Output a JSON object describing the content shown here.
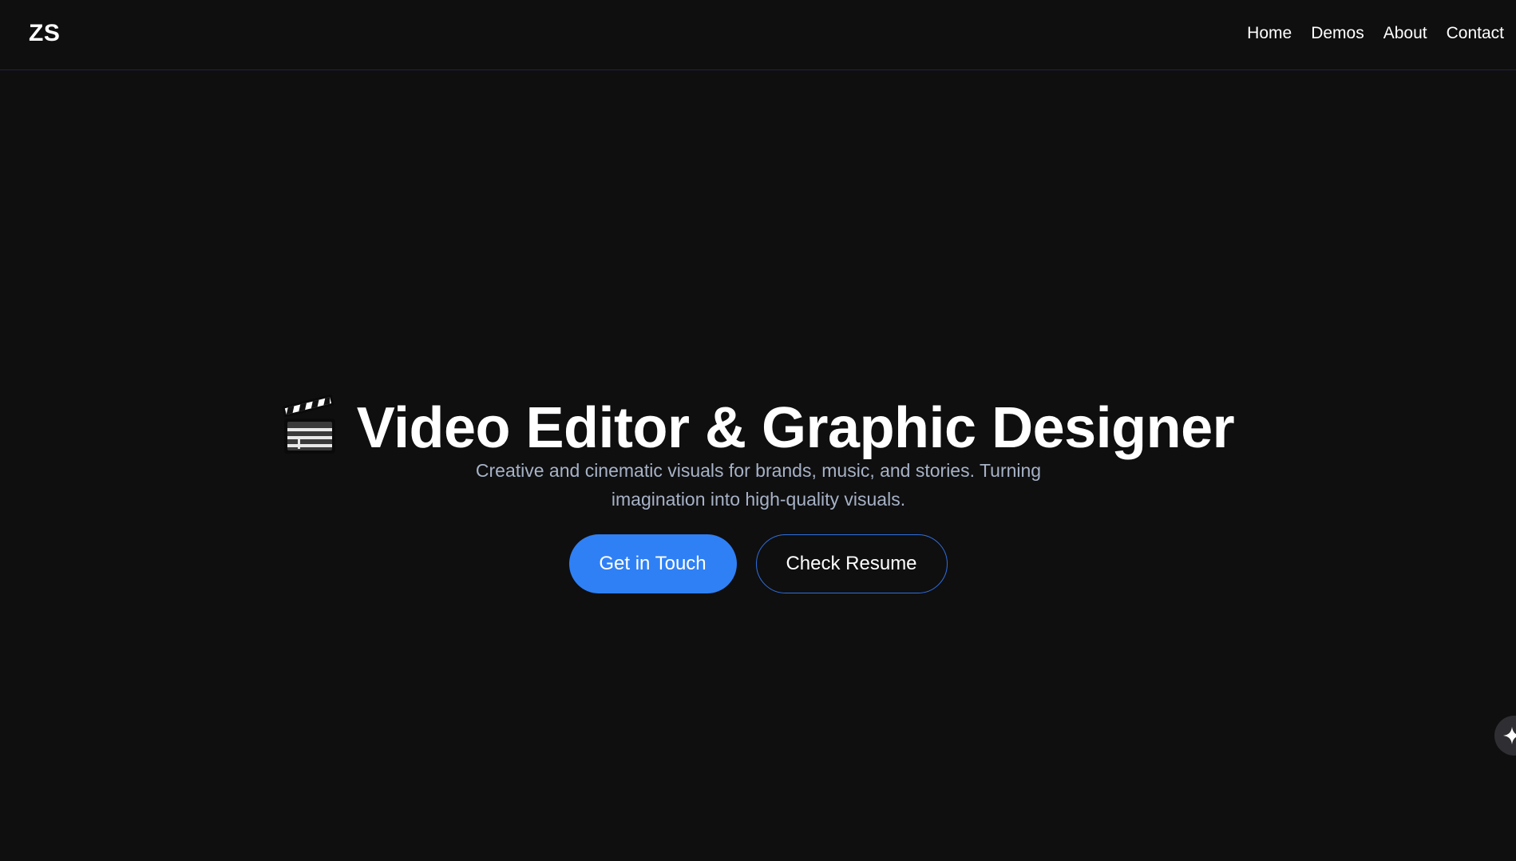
{
  "nav": {
    "logo": "ZS",
    "links": [
      "Home",
      "Demos",
      "About",
      "Contact"
    ]
  },
  "hero": {
    "icon": "clapperboard-icon",
    "title": "Video Editor & Graphic Designer",
    "subtitle": "Creative and cinematic visuals for brands, music, and stories. Turning imagination into high-quality visuals.",
    "primary_button": "Get in Touch",
    "secondary_button": "Check Resume"
  },
  "floating_button": {
    "icon": "sparkle-icon"
  },
  "colors": {
    "background": "#0f0f10",
    "accent": "#2f80f5",
    "subtitle_text": "#a7b2c6",
    "nav_border": "#24223d"
  }
}
